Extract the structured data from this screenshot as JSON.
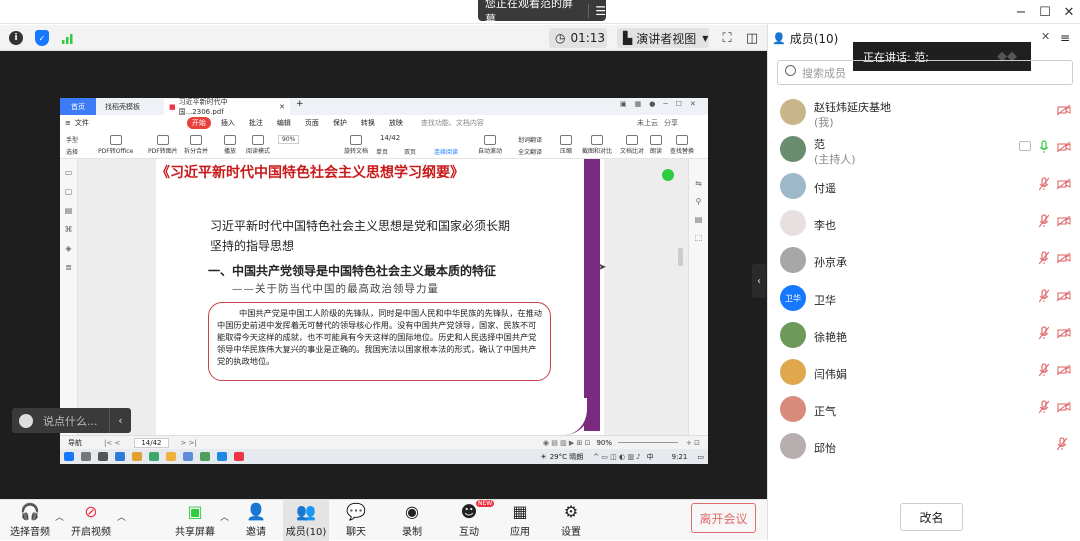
{
  "share_banner": {
    "text": "您正在观看范的屏幕",
    "menu_icon": "menu-icon"
  },
  "toolbar": {
    "timer": "01:13",
    "view_mode": "演讲者视图"
  },
  "shared_screen": {
    "wps": {
      "tabs": [
        "首页",
        "找稻壳模板",
        "习近平新时代中国...2306.pdf"
      ],
      "ribbon_tabs": [
        "文件",
        "开始",
        "插入",
        "批注",
        "编辑",
        "页面",
        "保护",
        "转换",
        "放映"
      ],
      "ribbon_tools": [
        "手型",
        "选择",
        "PDF转Office",
        "PDF转图片",
        "拆分合并",
        "播放",
        "阅读模式",
        "90%",
        "旋转文档",
        "单页",
        "双页",
        "连续阅读",
        "自动滚动",
        "划词翻译",
        "全文翻译",
        "压缩",
        "截图和对比",
        "文档比对",
        "朗读",
        "查找替换"
      ],
      "page_indicator": "14/42",
      "right_tabs": [
        "未上云",
        "分享"
      ],
      "search_hint": "查找功能、文档内容"
    },
    "document": {
      "title": "《习近平新时代中国特色社会主义思想学习纲要》",
      "heading": "习近平新时代中国特色社会主义思想是党和国家必须长期坚持的指导思想",
      "section": "一、中国共产党领导是中国特色社会主义最本质的特征",
      "subtitle": "——关于防当代中国的最高政治领导力量",
      "box_text": "中国共产党是中国工人阶级的先锋队，同时是中国人民和中华民族的先锋队，在推动中国历史前进中发挥着无可替代的领导核心作用。没有中国共产党领导，国家、民族不可能取得今天这样的成就，也不可能具有今天这样的国际地位。历史和人民选择中国共产党领导中华民族伟大复兴的事业是正确的。我国宪法以国家根本法的形式，确认了中国共产党的执政地位。"
    },
    "status_bar": {
      "nav": "导航",
      "page": "14/42",
      "zoom": "90%"
    },
    "taskbar": {
      "weather": "29°C 晴朗",
      "ime": "中",
      "time": "9:21"
    }
  },
  "chat_placeholder": "说点什么...",
  "bottom_bar": {
    "audio": "选择音频",
    "video": "开启视频",
    "share": "共享屏幕",
    "invite": "邀请",
    "members": "成员(10)",
    "chat": "聊天",
    "record": "录制",
    "interact": "互动",
    "new_badge": "NEW",
    "apps": "应用",
    "settings": "设置",
    "leave": "离开会议"
  },
  "panel": {
    "title": "成员(10)",
    "speaking": "正在讲话: 范;",
    "search_placeholder": "搜索成员",
    "rename": "改名",
    "members": [
      {
        "name": "赵钰炜延庆基地",
        "role": "(我)",
        "avatar_color": "#c8b58a"
      },
      {
        "name": "范",
        "role": "(主持人)",
        "avatar_color": "#6a8c6f"
      },
      {
        "name": "付遥",
        "role": "",
        "avatar_color": "#9db8c9"
      },
      {
        "name": "李也",
        "role": "",
        "avatar_color": "#e8e0e0"
      },
      {
        "name": "孙京承",
        "role": "",
        "avatar_color": "#a7a7a7"
      },
      {
        "name": "卫华",
        "role": "",
        "avatar_text": "卫华",
        "avatar_color": "#1677ff"
      },
      {
        "name": "徐艳艳",
        "role": "",
        "avatar_color": "#6d9a58"
      },
      {
        "name": "闫伟娟",
        "role": "",
        "avatar_color": "#e0a84c"
      },
      {
        "name": "正气",
        "role": "",
        "avatar_color": "#d98b7b"
      },
      {
        "name": "邱怡",
        "role": "",
        "avatar_color": "#b7aeb0"
      }
    ]
  },
  "colors": {
    "accent": "#1677ff",
    "muted_red": "#e06b6b",
    "active_green": "#2ecc40"
  }
}
